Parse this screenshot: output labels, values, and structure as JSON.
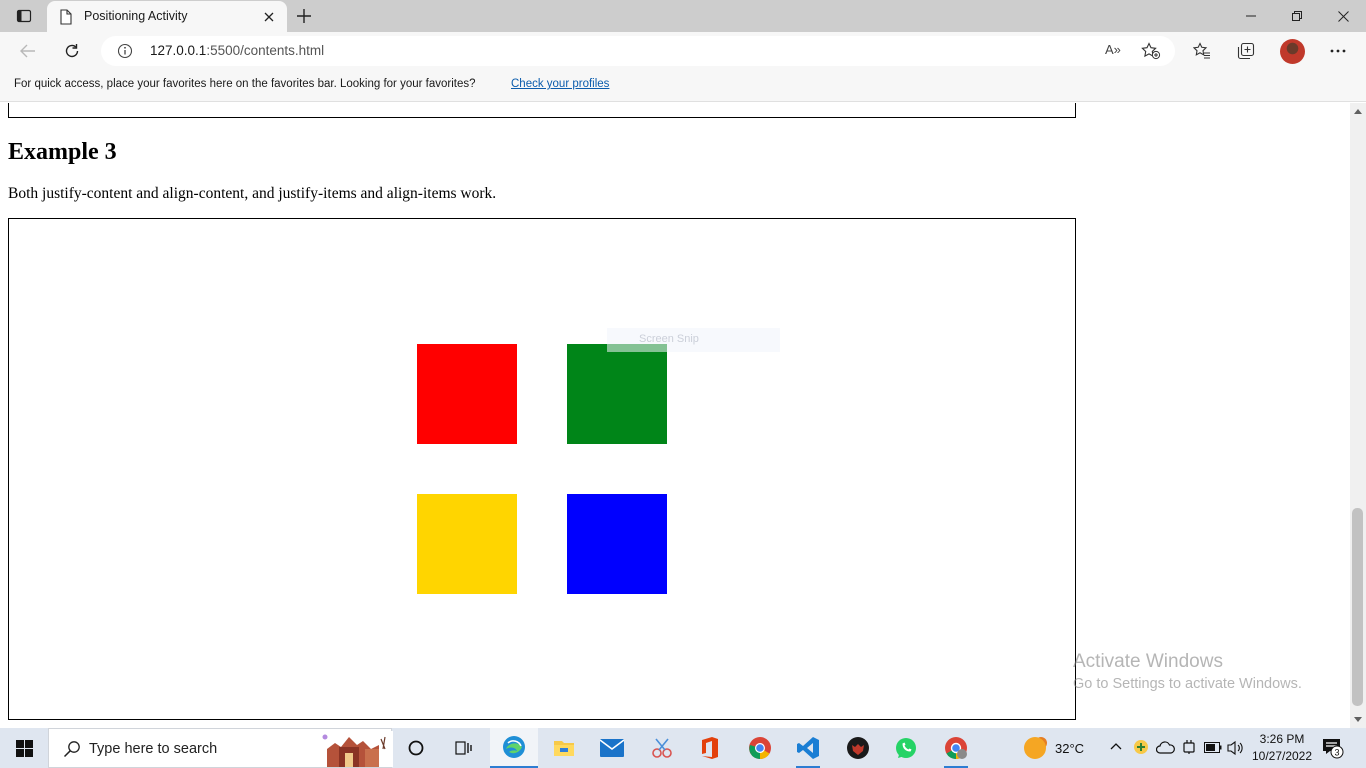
{
  "browser": {
    "tab": {
      "title": "Positioning Activity"
    },
    "address_bar": {
      "host": "127.0.0.1",
      "path": ":5500/contents.html",
      "read_aloud_label": "A»"
    },
    "favorites_bar": {
      "message": "For quick access, place your favorites here on the favorites bar. Looking for your favorites?",
      "link_text": "Check your profiles"
    }
  },
  "page": {
    "heading": "Example 3",
    "description": "Both justify-content and align-content, and justify-items and align-items work.",
    "squares": [
      {
        "name": "red-square",
        "color": "#ff0000"
      },
      {
        "name": "green-square",
        "color": "#008518"
      },
      {
        "name": "yellow-square",
        "color": "#ffd500"
      },
      {
        "name": "blue-square",
        "color": "#0000ff"
      }
    ],
    "overlay_text": "Screen Snip"
  },
  "watermark": {
    "line1": "Activate Windows",
    "line2": "Go to Settings to activate Windows."
  },
  "taskbar": {
    "search_placeholder": "Type here to search",
    "weather_temp": "32°C",
    "time": "3:26 PM",
    "date": "10/27/2022",
    "notification_count": "3"
  }
}
